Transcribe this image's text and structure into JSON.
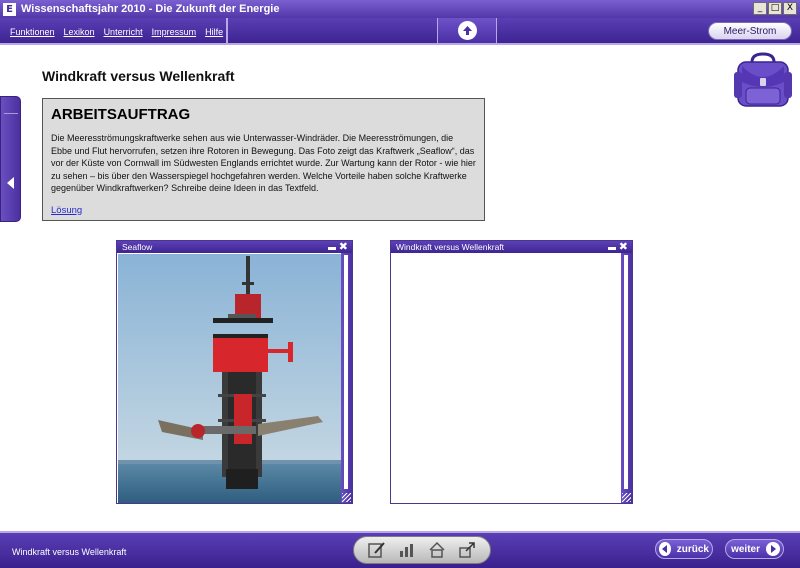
{
  "window": {
    "app_icon_letter": "E",
    "title": "Wissenschaftsjahr 2010 - Die Zukunft der Energie",
    "controls": [
      "_",
      "□",
      "X"
    ]
  },
  "menu": {
    "items": [
      "Funktionen",
      "Lexikon",
      "Unterricht",
      "Impressum",
      "Hilfe"
    ],
    "topic_button": "Meer-Strom"
  },
  "page": {
    "title": "Windkraft versus Wellenkraft"
  },
  "task": {
    "heading": "ARBEITSAUFTRAG",
    "text": "Die Meeresströmungskraftwerke sehen aus wie Unterwasser-Windräder. Die Meeresströmungen, die Ebbe und Flut hervorrufen, setzen ihre Rotoren in Bewegung. Das Foto zeigt das Kraftwerk „Seaflow“, das vor der Küste von Cornwall im Südwesten Englands errichtet wurde. Zur Wartung kann der Rotor - wie hier zu sehen – bis über den Wasserspiegel hochgefahren werden. Welche Vorteile haben solche Kraftwerke gegenüber Windkraftwerken? Schreibe deine Ideen in das Textfeld.",
    "link": "Lösung"
  },
  "panels": {
    "photo_title": "Seaflow",
    "text_title": "Windkraft versus Wellenkraft",
    "text_value": ""
  },
  "footer": {
    "title": "Windkraft versus Wellenkraft",
    "back": "zurück",
    "next": "weiter"
  },
  "colors": {
    "primary": "#4a2fa5",
    "accent": "#b9a8e6",
    "task_bg": "#dcdcdc"
  }
}
